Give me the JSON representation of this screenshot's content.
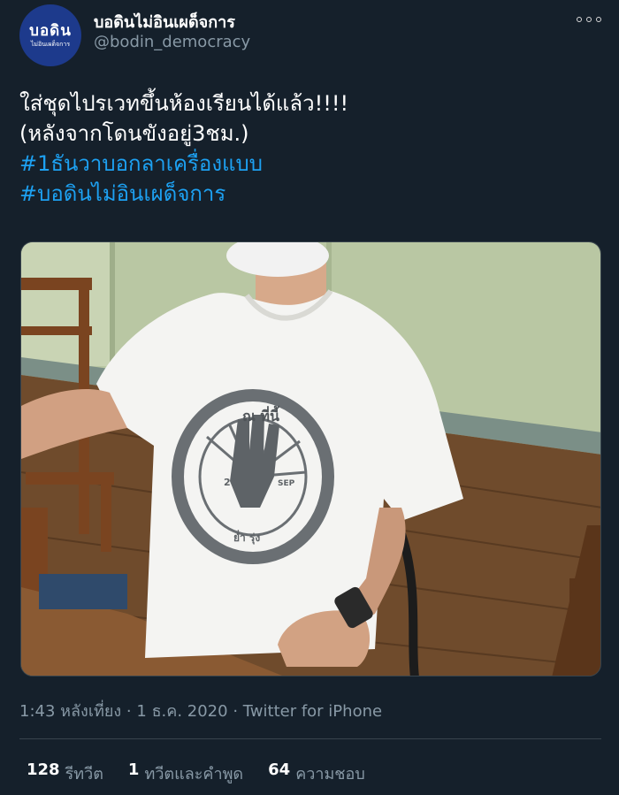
{
  "author": {
    "avatar_text_main": "บอดิน",
    "avatar_text_sub": "ไม่อินเผด็จการ",
    "display_name": "บอดินไม่อินเผด็จการ",
    "handle": "@bodin_democracy",
    "avatar_color": "#1d3a8c"
  },
  "tweet": {
    "lines": [
      {
        "text": "ใส่ชุดไปรเวทขึ้นห้องเรียนได้แล้ว!!!!",
        "hashtag": false
      },
      {
        "text": "(หลังจากโดนขังอยู่3ชม.)",
        "hashtag": false
      },
      {
        "text": "#1ธันวาบอกลาเครื่องแบบ",
        "hashtag": true
      },
      {
        "text": "#บอดินไม่อินเผด็จการ",
        "hashtag": true
      }
    ]
  },
  "media": {
    "shirt_logo_text": {
      "top": "ณ ที่นี้",
      "date_day": "20",
      "date_month": "SEP",
      "bottom": "ย่ำ รุ่ง"
    }
  },
  "meta": {
    "time": "1:43 หลังเที่ยง",
    "date": "1 ธ.ค. 2020",
    "separator": "·",
    "source": "Twitter for iPhone"
  },
  "stats": {
    "retweets": {
      "count": "128",
      "label": "รีทวีต"
    },
    "quotes": {
      "count": "1",
      "label": "ทวีตและคำพูด"
    },
    "likes": {
      "count": "64",
      "label": "ความชอบ"
    }
  },
  "colors": {
    "background": "#15202b",
    "text": "#ffffff",
    "secondary": "#8899a6",
    "link": "#1da1f2",
    "border": "#38444d"
  },
  "icons": {
    "more": "more-options-icon"
  }
}
